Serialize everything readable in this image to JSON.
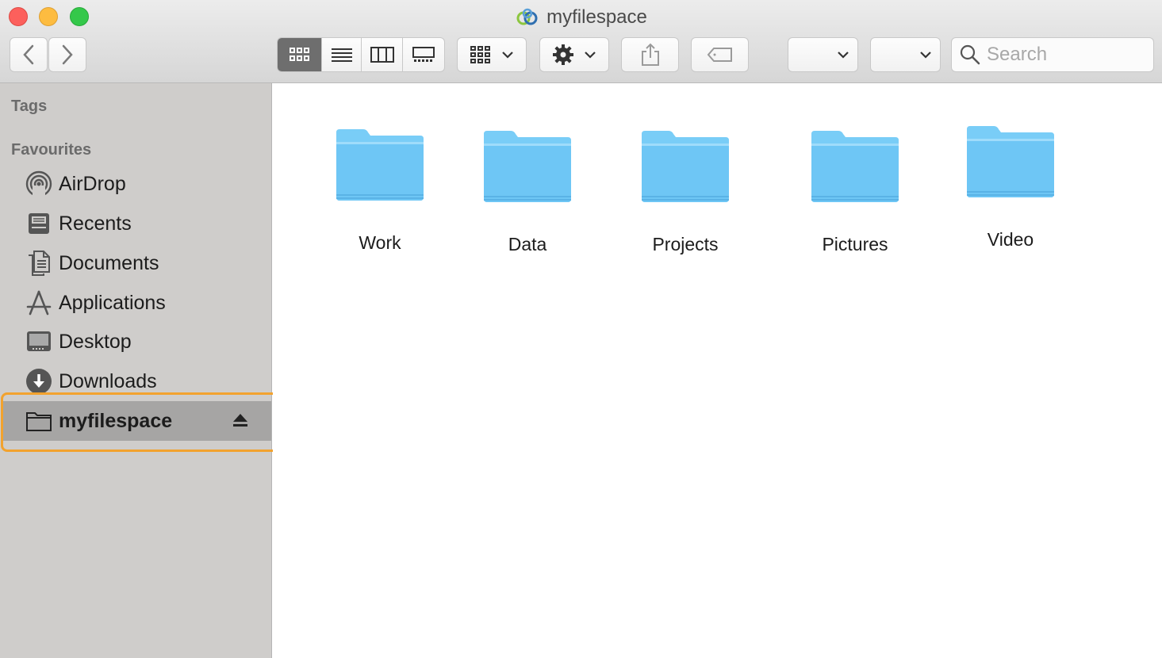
{
  "window": {
    "title": "myfilespace"
  },
  "toolbar": {
    "back_icon": "chevron-left-icon",
    "forward_icon": "chevron-right-icon",
    "view_modes": [
      "icon-view",
      "list-view",
      "column-view",
      "gallery-view"
    ],
    "active_view": "icon-view",
    "group_icon": "grid-group-icon",
    "action_icon": "gear-icon",
    "share_icon": "share-icon",
    "tag_icon": "tag-icon",
    "dropdown_1_value": "",
    "dropdown_2_value": "",
    "search_placeholder": "Search"
  },
  "sidebar": {
    "tags_heading": "Tags",
    "favourites_heading": "Favourites",
    "items": [
      {
        "label": "AirDrop",
        "icon": "airdrop-icon"
      },
      {
        "label": "Recents",
        "icon": "recents-icon"
      },
      {
        "label": "Documents",
        "icon": "documents-icon"
      },
      {
        "label": "Applications",
        "icon": "applications-icon"
      },
      {
        "label": "Desktop",
        "icon": "desktop-icon"
      },
      {
        "label": "Downloads",
        "icon": "downloads-icon"
      },
      {
        "label": "myfilespace",
        "icon": "folder-icon",
        "selected": true,
        "ejectable": true
      }
    ]
  },
  "content": {
    "folders": [
      {
        "name": "Work"
      },
      {
        "name": "Data"
      },
      {
        "name": "Projects"
      },
      {
        "name": "Pictures"
      },
      {
        "name": "Video"
      }
    ]
  },
  "colors": {
    "folder_blue": "#6ec6f5",
    "highlight_orange": "#f2a22e",
    "sidebar_bg": "#cfcdcb",
    "selected_bg": "#a6a5a4"
  }
}
